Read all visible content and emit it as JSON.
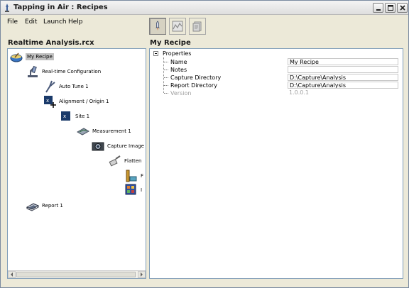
{
  "window": {
    "title": "Tapping in Air : Recipes",
    "controls": [
      "minimize",
      "maximize",
      "close"
    ]
  },
  "menu": [
    "File",
    "Edit",
    "Launch",
    "Help"
  ],
  "toolbar": {
    "buttons": [
      {
        "icon": "rocket-icon",
        "active": true
      },
      {
        "icon": "chart-icon",
        "active": false
      },
      {
        "icon": "document-icon",
        "active": false
      }
    ]
  },
  "left_panel": {
    "heading": "Realtime Analysis.rcx",
    "tree": [
      {
        "label": "My Recipe",
        "icon": "bowl-icon",
        "selected": true
      },
      {
        "label": "Real-time Configuration",
        "icon": "microscope-icon"
      },
      {
        "label": "Auto Tune 1",
        "icon": "tuning-fork-icon"
      },
      {
        "label": "Alignment / Origin 1",
        "icon": "alignment-icon"
      },
      {
        "label": "Site 1",
        "icon": "site-icon"
      },
      {
        "label": "Measurement 1",
        "icon": "measurement-icon"
      },
      {
        "label": "Capture Image",
        "icon": "camera-icon"
      },
      {
        "label": "Flatten",
        "icon": "flatten-icon"
      },
      {
        "label": "F",
        "icon": "ruler-icon"
      },
      {
        "label": "I",
        "icon": "image-grid-icon"
      },
      {
        "label": "Report 1",
        "icon": "report-icon"
      }
    ]
  },
  "right_panel": {
    "heading": "My Recipe",
    "properties": {
      "group": "Properties",
      "rows": [
        {
          "name": "Name",
          "value": "My Recipe"
        },
        {
          "name": "Notes",
          "value": ""
        },
        {
          "name": "Capture Directory",
          "value": "D:\\Capture\\Analysis"
        },
        {
          "name": "Report Directory",
          "value": "D:\\Capture\\Analysis"
        },
        {
          "name": "Version",
          "value": "1.0.0.1",
          "disabled": true
        }
      ]
    }
  }
}
